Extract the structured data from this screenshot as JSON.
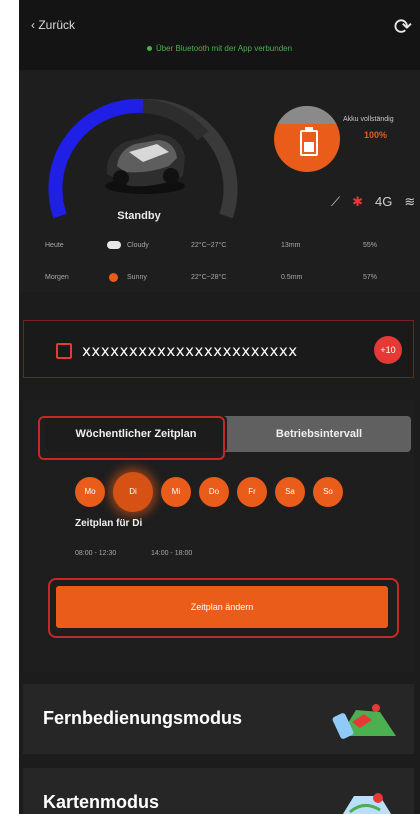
{
  "topbar": {
    "back_label": "‹ Zurück",
    "connection_text": "Über Bluetooth mit der App verbunden"
  },
  "status": {
    "state_label": "Standby",
    "battery_label": "Akku vollständig",
    "battery_percent": "100%",
    "battery_level": 1.0,
    "indicator_icons": [
      "rain-sensor-icon",
      "bluetooth-icon",
      "4g-signal-icon",
      "wifi-icon"
    ],
    "weather": [
      {
        "day": "Heute",
        "cond": "Cloudy",
        "temp": "22°C~27°C",
        "rain": "13mm",
        "humidity": "55%"
      },
      {
        "day": "Morgen",
        "cond": "Sunny",
        "temp": "22°C~28°C",
        "rain": "0.5mm",
        "humidity": "57%"
      }
    ]
  },
  "error_box": {
    "text": "xxxxxxxxxxxxxxxxxxxxxxx",
    "badge": "+10"
  },
  "schedule": {
    "tab_weekly": "Wöchentlicher Zeitplan",
    "tab_interval": "Betriebsintervall",
    "days": [
      "Mo",
      "Di",
      "Mi",
      "Do",
      "Fr",
      "Sa",
      "So"
    ],
    "active_day": "Di",
    "schedule_for": "Zeitplan für Di",
    "slots": [
      "08:00 - 12:30",
      "14:00 - 18:00"
    ],
    "change_button": "Zeitplan ändern"
  },
  "modes": {
    "remote": "Fernbedienungsmodus",
    "map": "Kartenmodus"
  },
  "colors": {
    "accent": "#e95c1a",
    "gauge": "#1f1fe6",
    "background": "#1c1c1c",
    "highlight_ring": "#c62828"
  }
}
